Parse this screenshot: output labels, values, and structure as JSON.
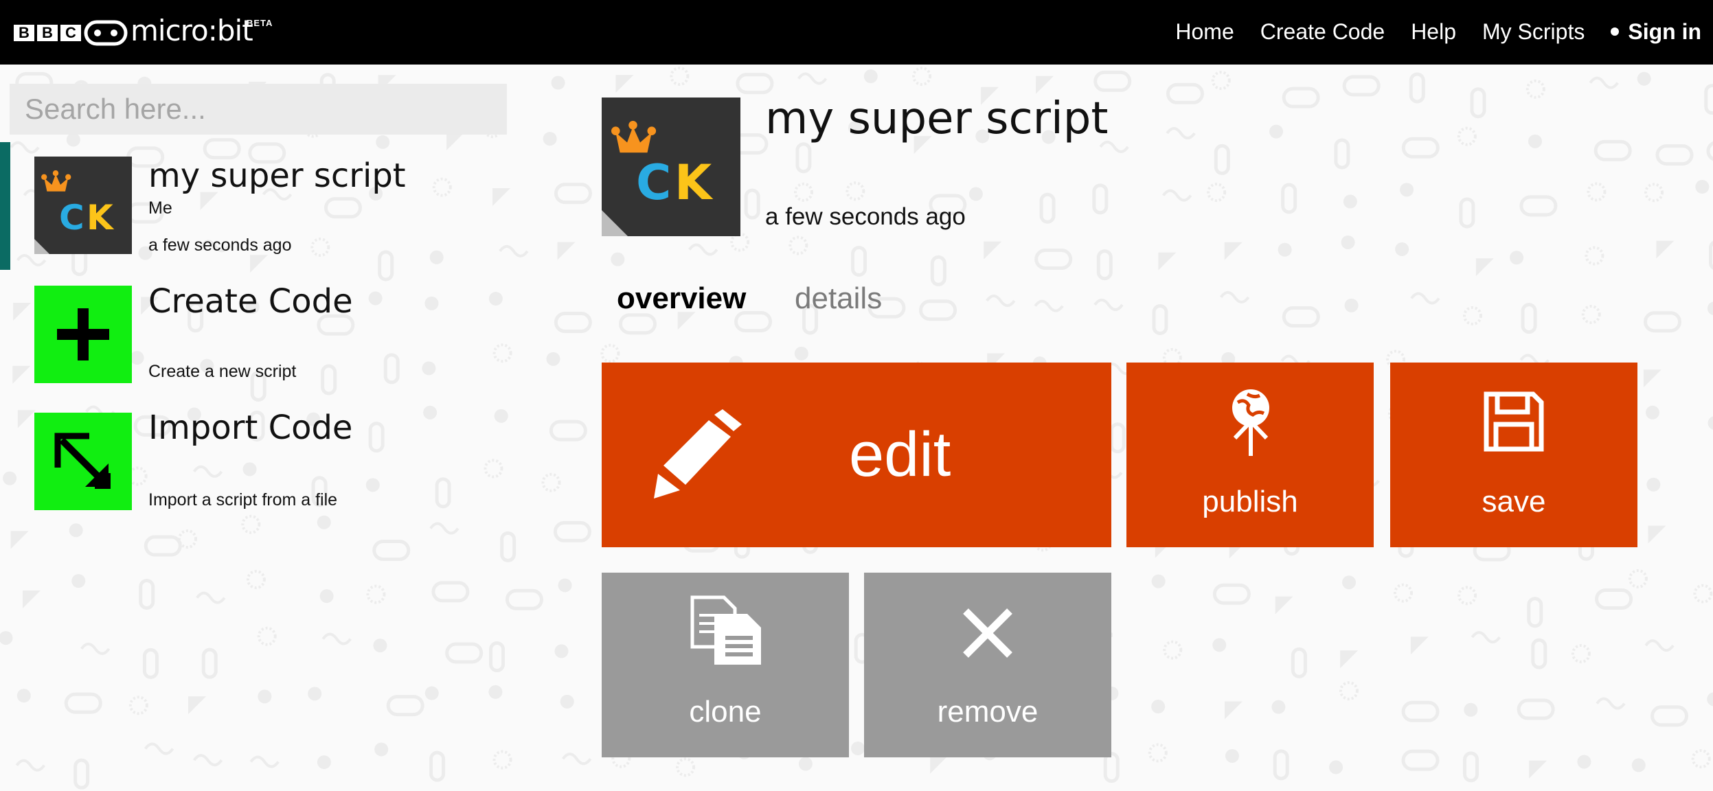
{
  "header": {
    "bbc_letters": [
      "B",
      "B",
      "C"
    ],
    "brand": "micro:bit",
    "beta": "BETA",
    "nav": {
      "home": "Home",
      "create_code": "Create Code",
      "help": "Help",
      "my_scripts": "My Scripts",
      "sign_in": "Sign in"
    }
  },
  "search": {
    "placeholder": "Search here..."
  },
  "sidebar": {
    "items": [
      {
        "title": "my super script",
        "author": "Me",
        "subtitle": "a few seconds ago",
        "selected": true
      },
      {
        "title": "Create Code",
        "subtitle": "Create a new script"
      },
      {
        "title": "Import Code",
        "subtitle": "Import a script from a file"
      }
    ]
  },
  "script": {
    "title": "my super script",
    "time": "a few seconds ago",
    "thumb_letters": "CK"
  },
  "tabs": {
    "overview": "overview",
    "details": "details"
  },
  "actions": {
    "edit": "edit",
    "publish": "publish",
    "save": "save",
    "clone": "clone",
    "remove": "remove"
  },
  "colors": {
    "accent_orange": "#d93f00",
    "grey_button": "#9a9a9a",
    "green_tile": "#11ee11",
    "selected_bar": "#0b6b63",
    "thumb_dark": "#333333",
    "topbar": "#000000"
  },
  "icons": {
    "edit": "pencil-icon",
    "publish": "upload-globe-icon",
    "save": "floppy-disk-icon",
    "clone": "copy-documents-icon",
    "remove": "close-icon",
    "create": "plus-icon",
    "import": "import-arrow-icon"
  }
}
